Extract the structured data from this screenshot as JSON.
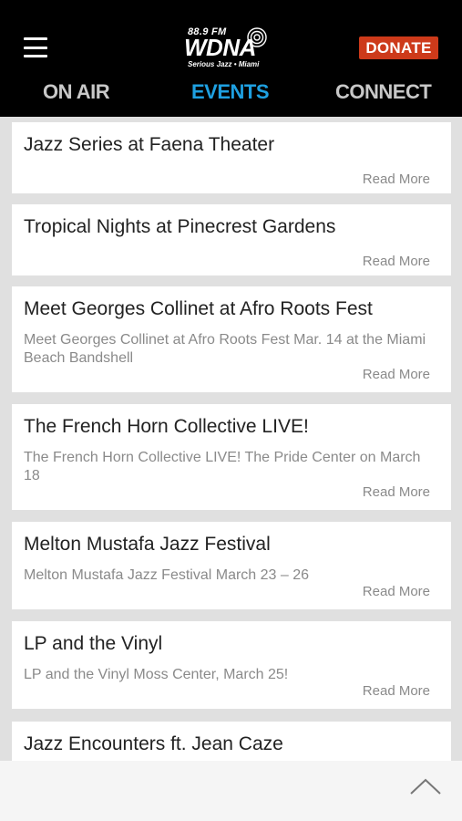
{
  "header": {
    "logo": {
      "frequency": "88.9 FM",
      "name": "WDNA",
      "tagline": "Serious Jazz • Miami"
    },
    "menu_icon": "hamburger-menu-icon",
    "donate_label": "DONATE",
    "tabs": [
      {
        "label": "ON AIR",
        "active": false
      },
      {
        "label": "EVENTS",
        "active": true
      },
      {
        "label": "CONNECT",
        "active": false
      }
    ]
  },
  "events": [
    {
      "title": "Jazz Series at Faena Theater",
      "description": "",
      "read_more": "Read More"
    },
    {
      "title": "Tropical Nights at Pinecrest Gardens",
      "description": "",
      "read_more": "Read More"
    },
    {
      "title": "Meet Georges Collinet at Afro Roots Fest",
      "description": "Meet Georges Collinet at Afro Roots Fest Mar. 14 at the Miami Beach Bandshell",
      "read_more": "Read More"
    },
    {
      "title": "The French Horn Collective LIVE!",
      "description": "The French Horn Collective LIVE! The Pride Center on March 18",
      "read_more": "Read More"
    },
    {
      "title": "Melton Mustafa Jazz Festival",
      "description": "Melton Mustafa Jazz Festival March 23 – 26",
      "read_more": "Read More"
    },
    {
      "title": "LP and the Vinyl",
      "description": "LP and the Vinyl Moss Center, March 25!",
      "read_more": "Read More"
    },
    {
      "title": "Jazz Encounters ft. Jean Caze",
      "description": "",
      "read_more": ""
    }
  ],
  "footer": {
    "scroll_top_icon": "chevron-up-icon"
  },
  "colors": {
    "header_bg": "#000000",
    "active_tab": "#1ea0e1",
    "inactive_tab": "#c8c8c8",
    "donate_bg": "#cd3a1a",
    "page_bg": "#e0e0e0"
  }
}
